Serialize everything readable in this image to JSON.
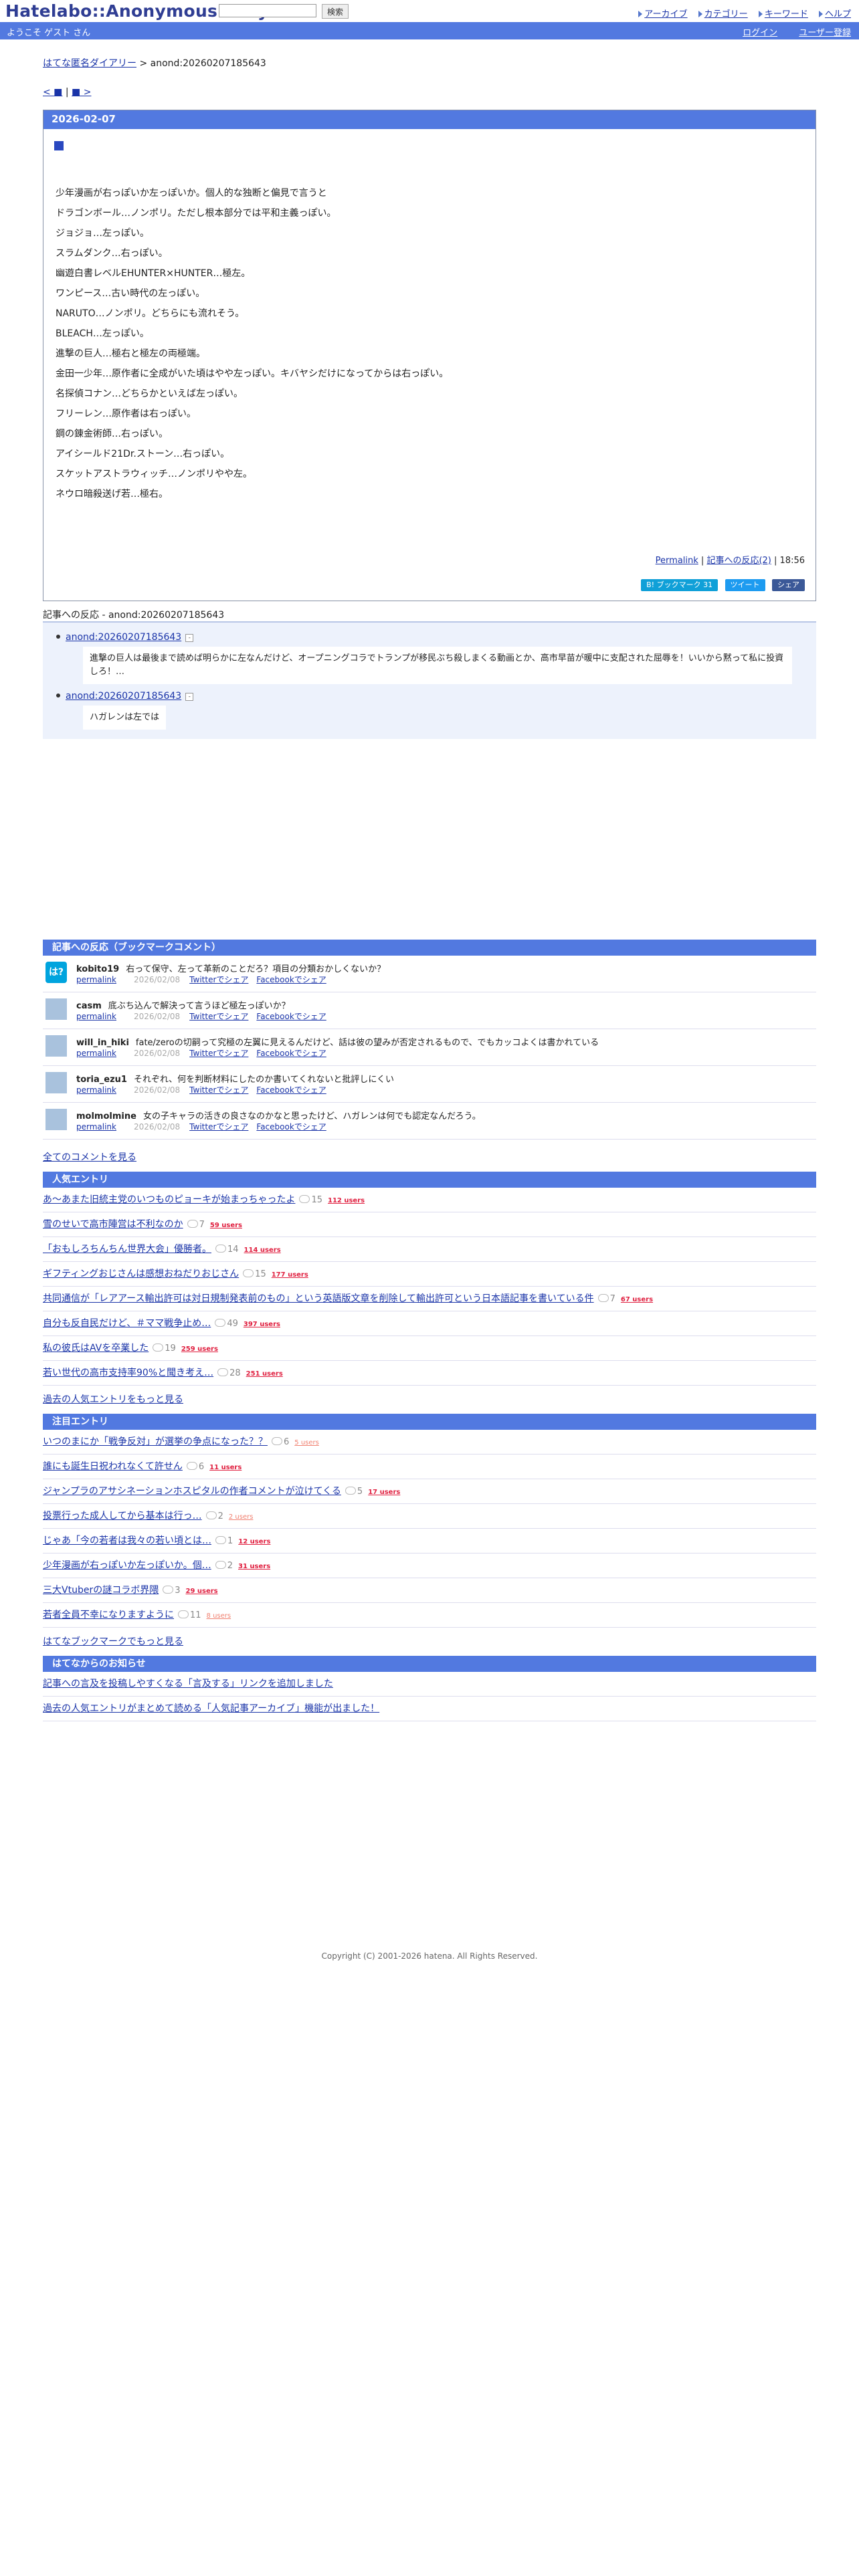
{
  "header": {
    "logo": "Hatelabo::AnonymousDiary",
    "search_button": "検索",
    "nav": [
      "アーカイブ",
      "カテゴリー",
      "キーワード",
      "ヘルプ"
    ],
    "welcome": "ようこそ ゲスト さん",
    "login": "ログイン",
    "register": "ユーザー登録"
  },
  "breadcrumb": {
    "home": "はてな匿名ダイアリー",
    "separator": ">",
    "current": "anond:20260207185643"
  },
  "pager": {
    "prev": "< ■",
    "sep": "|",
    "next": "■ >"
  },
  "entry": {
    "date": "2026-02-07",
    "title_mark": "■",
    "lines": [
      "少年漫画が右っぽいか左っぽいか。個人的な独断と偏見で言うと",
      "ドラゴンボール…ノンポリ。ただし根本部分では平和主義っぽい。",
      "ジョジョ…左っぽい。",
      "スラムダンク…右っぽい。",
      "幽遊白書レベルEHUNTER×HUNTER…極左。",
      "ワンピース…古い時代の左っぽい。",
      "NARUTO…ノンポリ。どちらにも流れそう。",
      "BLEACH…左っぽい。",
      "進撃の巨人…極右と極左の両極端。",
      "金田一少年…原作者に全成がいた頃はやや左っぽい。キバヤシだけになってからは右っぽい。",
      "名探偵コナン…どちらかといえば左っぽい。",
      "フリーレン…原作者は右っぽい。",
      "鋼の錬金術師…右っぽい。",
      "アイシールド21Dr.ストーン…右っぽい。",
      "スケットアストラウィッチ…ノンポリやや左。",
      "ネウロ暗殺送げ若…極右。"
    ],
    "permalink": "Permalink",
    "reaction_link": "記事への反応(2)",
    "time": "18:56",
    "share_hatena": "B! ブックマーク 31",
    "share_twitter": "ツイート",
    "share_facebook": "シェア"
  },
  "reactions": {
    "title": "記事への反応 - anond:20260207185643",
    "items": [
      {
        "id": "anond:20260207185643",
        "toggle": "-",
        "text": "進撃の巨人は最後まで読めば明らかに左なんだけど、オープニングコラでトランプが移民ぶち殺しまくる動画とか、高市早苗が暖中に支配された屈辱を！いいから黙って私に投資しろ！…"
      },
      {
        "id": "anond:20260207185643",
        "toggle": "-",
        "text": "ハガレンは左では"
      }
    ]
  },
  "bookmarks": {
    "title": "記事への反応（ブックマークコメント）",
    "permalink": "permalink",
    "twitter": "Twitterでシェア",
    "facebook": "Facebookでシェア",
    "hatena_avatar": "は?",
    "comments": [
      {
        "user": "kobito19",
        "text": "右って保守、左って革新のことだろ？項目の分類おかしくないか？",
        "date": "2026/02/08"
      },
      {
        "user": "casm",
        "text": "底ぶち込んで解決って言うほど極左っぽいか？",
        "date": "2026/02/08"
      },
      {
        "user": "will_in_hiki",
        "text": "fate/zeroの切嗣って究極の左翼に見えるんだけど、話は彼の望みが否定されるもので、でもカッコよくは書かれている",
        "date": "2026/02/08"
      },
      {
        "user": "toria_ezu1",
        "text": "それぞれ、何を判断材料にしたのか書いてくれないと批評しにくい",
        "date": "2026/02/08"
      },
      {
        "user": "molmolmine",
        "text": "女の子キャラの活きの良さなのかなと思ったけど、ハガレンは何でも認定なんだろう。",
        "date": "2026/02/08"
      }
    ],
    "all_comments": "全てのコメントを見る"
  },
  "popular": {
    "title": "人気エントリ",
    "items": [
      {
        "text": "あ〜あまた旧統主党のいつものピョーキが始まっちゃったよ",
        "count": "15",
        "users": "112 users",
        "low": false
      },
      {
        "text": "雪のせいで高市陣営は不利なのか",
        "count": "7",
        "users": "59 users",
        "low": false
      },
      {
        "text": "「おもしろちんちん世界大会」優勝者。",
        "count": "14",
        "users": "114 users",
        "low": false
      },
      {
        "text": "ギフティングおじさんは感想おねだりおじさん",
        "count": "15",
        "users": "177 users",
        "low": false
      },
      {
        "text": "共同通信が「レアアース輸出許可は対日規制発表前のもの」という英語版文章を削除して輸出許可という日本語記事を書いている件",
        "count": "7",
        "users": "67 users",
        "low": false
      },
      {
        "text": "自分も反自民だけど、＃ママ戦争止め…",
        "count": "49",
        "users": "397 users",
        "low": false
      },
      {
        "text": "私の彼氏はAVを卒業した",
        "count": "19",
        "users": "259 users",
        "low": false
      },
      {
        "text": "若い世代の高市支持率90%と聞き考え…",
        "count": "28",
        "users": "251 users",
        "low": false
      }
    ],
    "more": "過去の人気エントリをもっと見る"
  },
  "notable": {
    "title": "注目エントリ",
    "items": [
      {
        "text": "いつのまにか「戦争反対」が選挙の争点になった？？",
        "count": "6",
        "users": "5 users",
        "low": true
      },
      {
        "text": "誰にも誕生日祝われなくて許せん",
        "count": "6",
        "users": "11 users",
        "low": false
      },
      {
        "text": "ジャンプラのアサシネーションホスピタルの作者コメントが泣けてくる",
        "count": "5",
        "users": "17 users",
        "low": false
      },
      {
        "text": "投票行った成人してから基本は行っ…",
        "count": "2",
        "users": "2 users",
        "low": true
      },
      {
        "text": "じゃあ「今の若者は我々の若い頃とは…",
        "count": "1",
        "users": "12 users",
        "low": false
      },
      {
        "text": "少年漫画が右っぽいか左っぽいか。個…",
        "count": "2",
        "users": "31 users",
        "low": false
      },
      {
        "text": "三大Vtuberの謎コラボ界隈",
        "count": "3",
        "users": "29 users",
        "low": false
      },
      {
        "text": "若者全員不幸になりますように",
        "count": "11",
        "users": "8 users",
        "low": true
      }
    ],
    "more": "はてなブックマークでもっと見る"
  },
  "news": {
    "title": "はてなからのお知らせ",
    "items": [
      "記事への言及を投稿しやすくなる「言及する」リンクを追加しました",
      "過去の人気エントリがまとめて読める「人気記事アーカイブ」機能が出ました！"
    ]
  },
  "copyright": "Copyright (C) 2001-2026 hatena. All Rights Reserved."
}
